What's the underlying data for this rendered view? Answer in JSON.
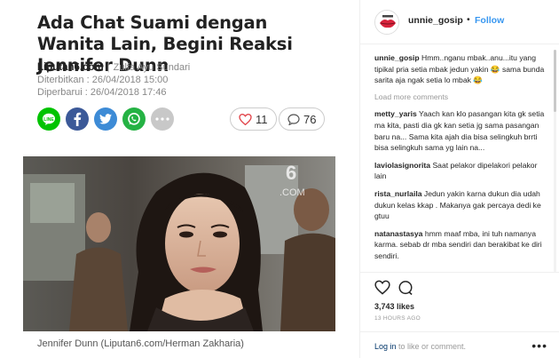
{
  "article": {
    "headline": "Ada Chat Suami dengan Wanita Lain, Begini Reaksi Jennifer Dunn",
    "site": "Liputan6.com",
    "author": "Zulfa Ayu Sundari",
    "published": "Diterbitkan : 26/04/2018 15:00",
    "updated": "Diperbarui : 26/04/2018 17:46",
    "likes": "11",
    "comments": "76",
    "caption": "Jennifer Dunn (Liputan6.com/Herman Zakharia)",
    "watermark_number": "6",
    "watermark_text": ".COM"
  },
  "share_icons": [
    "line-icon",
    "facebook-icon",
    "twitter-icon",
    "whatsapp-icon",
    "more-icon"
  ],
  "instagram": {
    "username": "unnie_gosip",
    "dot": "•",
    "follow": "Follow",
    "caption_user": "unnie_gosip",
    "caption_text": "Hmm..nganu mbak..anu...itu yang tipikal pria setia mbak jedun yakin 😂 sama bunda sarita aja ngak setia lo mbak 😂",
    "load_more": "Load more comments",
    "comments": [
      {
        "user": "metty_yaris",
        "text": "Yaach kan klo pasangan kita gk setia ma kita, pasti dia gk kan setia jg sama pasangan baru na... Sama kita ajah dia bisa selingkuh brrti bisa selingkuh sama yg lain na..."
      },
      {
        "user": "laviolasignorita",
        "text": "Saat pelakor dipelakori pelakor lain"
      },
      {
        "user": "rista_nurlaila",
        "text": "Jedun yakin karna dukun dia udah dukun kelas kkap . Makanya gak percaya dedi ke gtuu"
      },
      {
        "user": "natanastasya",
        "text": "hmm maaf mba, ini tuh namanya karma. sebab dr mba sendiri dan berakibat ke diri sendiri."
      }
    ],
    "likes": "3,743 likes",
    "time_ago": "13 HOURS AGO",
    "login_link": "Log in",
    "login_rest": " to like or comment.",
    "more": "•••"
  },
  "colors": {
    "line": "#00c300",
    "facebook": "#3b5998",
    "twitter": "#3d8bd6",
    "whatsapp": "#25b244",
    "more": "#c8c8c8",
    "heart": "#e2454b",
    "ig_blue": "#3897f0"
  }
}
